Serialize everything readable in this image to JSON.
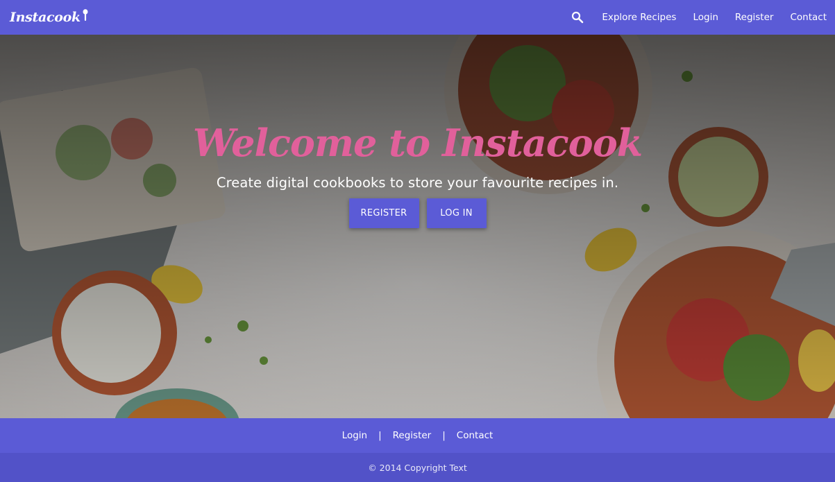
{
  "navbar": {
    "brand": "Instacook",
    "links": [
      "Explore Recipes",
      "Login",
      "Register",
      "Contact"
    ],
    "icons": {
      "search": "search-icon",
      "brand_mark": "spoon-icon"
    }
  },
  "hero": {
    "title": "Welcome to Instacook",
    "subtitle": "Create digital cookbooks to store your favourite recipes in.",
    "register_button": "REGISTER",
    "login_button": "LOG IN"
  },
  "footer": {
    "links": [
      "Login",
      "Register",
      "Contact"
    ],
    "separator": "|",
    "copyright": "© 2014 Copyright Text"
  },
  "colors": {
    "primary": "#5b5bd6",
    "footer_bottom": "#5252c8",
    "title_pink": "#e1609b"
  }
}
